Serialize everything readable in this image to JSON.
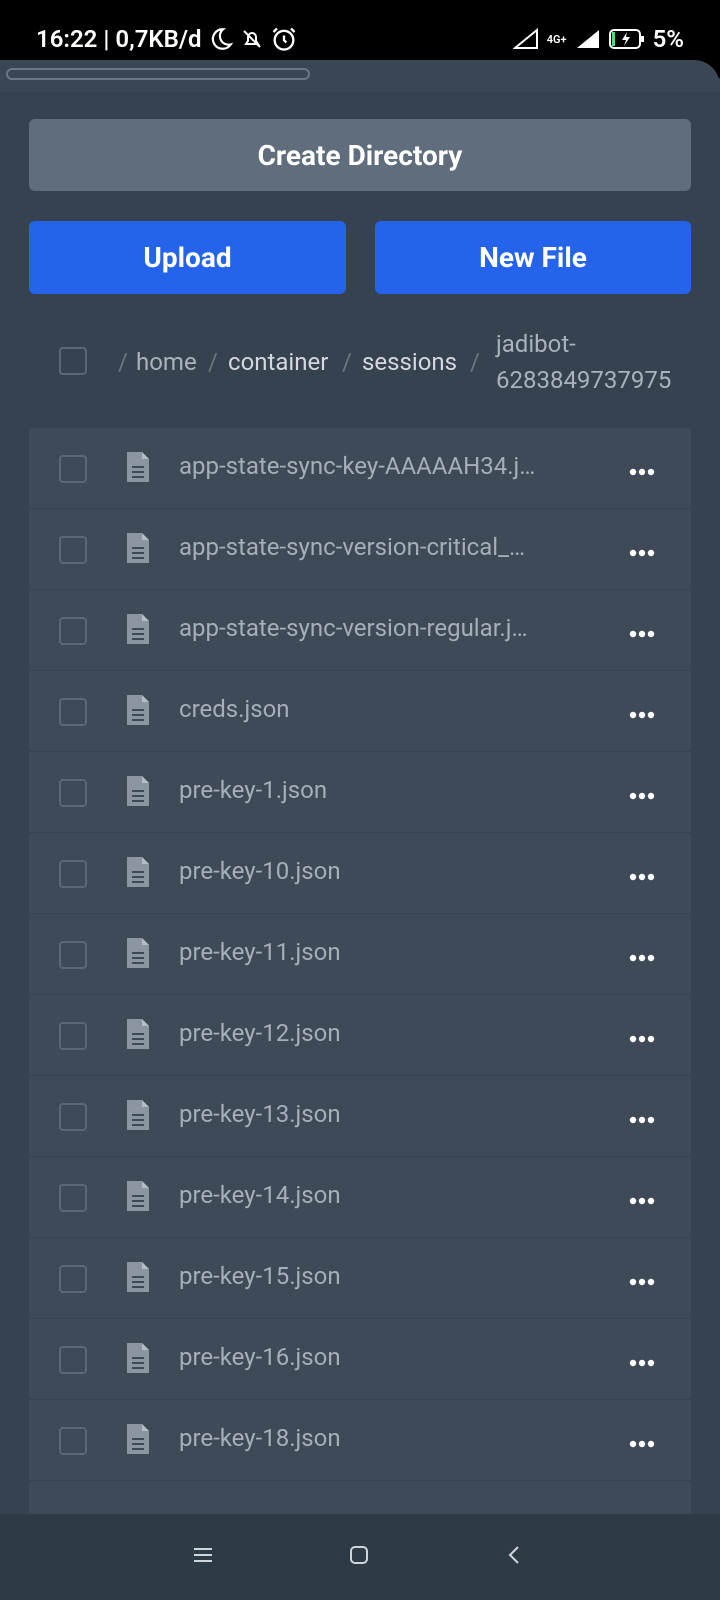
{
  "status_bar": {
    "time": "16:22",
    "speed": "| 0,7KB/d",
    "network": "4G+",
    "battery": "5%"
  },
  "actions": {
    "create_directory": "Create Directory",
    "upload": "Upload",
    "new_file": "New File"
  },
  "breadcrumb": {
    "segments": [
      "home",
      "container",
      "sessions"
    ],
    "current_line1": "jadibot-",
    "current_line2": "6283849737975"
  },
  "files": [
    "app-state-sync-key-AAAAAH34.j…",
    "app-state-sync-version-critical_…",
    "app-state-sync-version-regular.j…",
    "creds.json",
    "pre-key-1.json",
    "pre-key-10.json",
    "pre-key-11.json",
    "pre-key-12.json",
    "pre-key-13.json",
    "pre-key-14.json",
    "pre-key-15.json",
    "pre-key-16.json",
    "pre-key-18.json"
  ],
  "colors": {
    "primary": "#2563eb",
    "secondary_button": "#5f6d7c",
    "background": "#364250",
    "row": "#3f4a58"
  }
}
